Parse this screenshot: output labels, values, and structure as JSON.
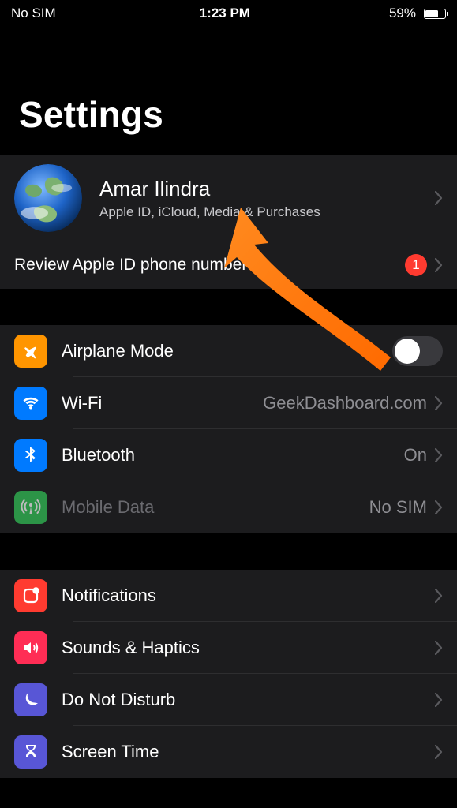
{
  "status": {
    "carrier": "No SIM",
    "time": "1:23 PM",
    "battery_pct": "59%"
  },
  "title": "Settings",
  "profile": {
    "name": "Amar Ilindra",
    "subtitle": "Apple ID, iCloud, Media & Purchases"
  },
  "review": {
    "label": "Review Apple ID phone number",
    "badge_count": "1"
  },
  "connectivity": {
    "airplane": {
      "label": "Airplane Mode",
      "on": false
    },
    "wifi": {
      "label": "Wi-Fi",
      "value": "GeekDashboard.com"
    },
    "bluetooth": {
      "label": "Bluetooth",
      "value": "On"
    },
    "mobile_data": {
      "label": "Mobile Data",
      "value": "No SIM"
    }
  },
  "system": {
    "notifications": {
      "label": "Notifications"
    },
    "sounds": {
      "label": "Sounds & Haptics"
    },
    "dnd": {
      "label": "Do Not Disturb"
    },
    "screen_time": {
      "label": "Screen Time"
    }
  }
}
